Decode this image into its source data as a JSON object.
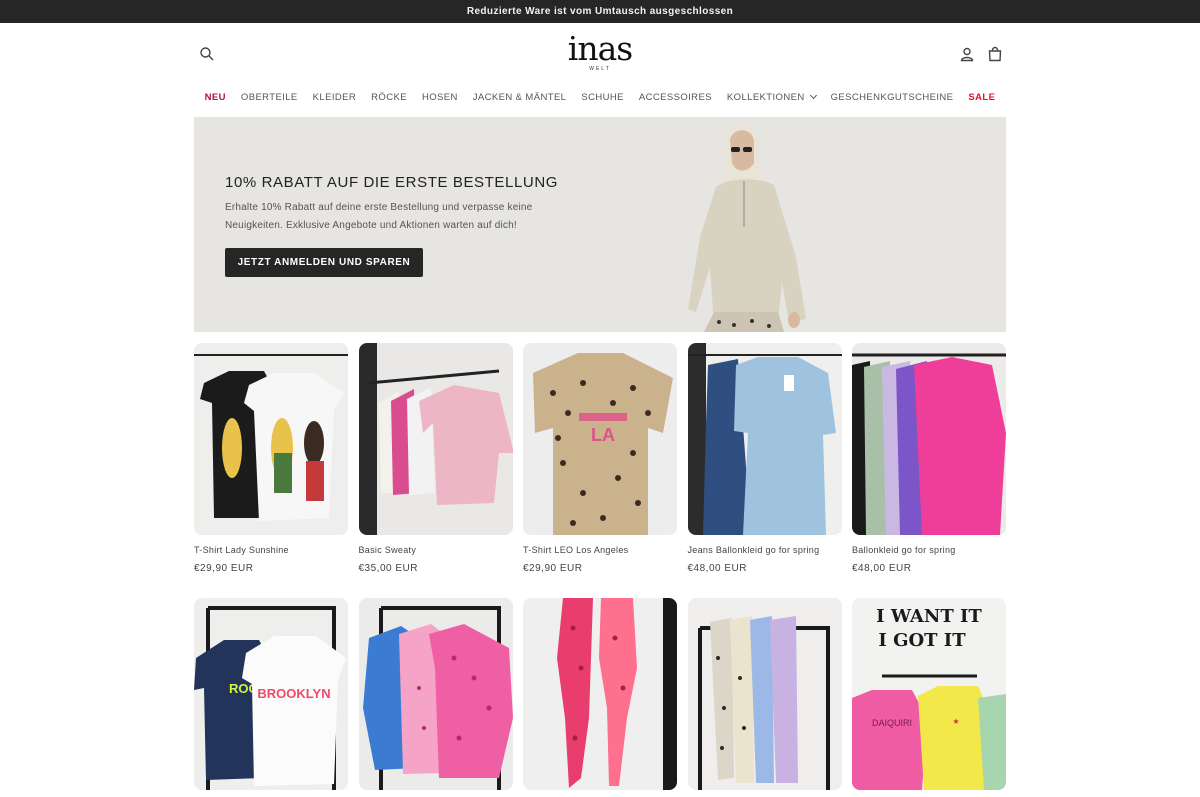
{
  "announcement": {
    "text": "Reduzierte Ware ist vom Umtausch ausgeschlossen"
  },
  "header": {
    "logo_main": "inas",
    "logo_sub": "WELT"
  },
  "nav": {
    "items": [
      {
        "label": "NEU",
        "color": "#b5123c"
      },
      {
        "label": "OBERTEILE"
      },
      {
        "label": "KLEIDER"
      },
      {
        "label": "RÖCKE"
      },
      {
        "label": "HOSEN"
      },
      {
        "label": "JACKEN & MÄNTEL"
      },
      {
        "label": "SCHUHE"
      },
      {
        "label": "ACCESSOIRES"
      },
      {
        "label": "KOLLEKTIONEN"
      },
      {
        "label": "GESCHENKGUTSCHEINE"
      },
      {
        "label": "SALE",
        "color": "#e0122e"
      }
    ]
  },
  "hero": {
    "title": "10% RABATT AUF DIE ERSTE BESTELLUNG",
    "text": "Erhalte 10% Rabatt auf deine erste Bestellung und verpasse keine Neuigkeiten. Exklusive Angebote und Aktionen warten auf dich!",
    "cta": "JETZT ANMELDEN UND SPAREN"
  },
  "products": [
    {
      "title": "T-Shirt Lady Sunshine",
      "price": "€29,90 EUR"
    },
    {
      "title": "Basic Sweaty",
      "price": "€35,00 EUR"
    },
    {
      "title": "T-Shirt LEO Los Angeles",
      "price": "€29,90 EUR"
    },
    {
      "title": "Jeans Ballonkleid go for spring",
      "price": "€48,00 EUR"
    },
    {
      "title": "Ballonkleid go for spring",
      "price": "€48,00 EUR"
    }
  ],
  "second_row": {
    "shirt_text_1": "ROOK",
    "shirt_text_2": "BROOKLYN",
    "sign_line_1": "I WANT IT",
    "sign_line_2": "I GOT IT"
  },
  "colors": {
    "accent_red": "#e0122e",
    "new_red": "#b5123c",
    "dark": "#262626",
    "hero_bg": "#e6e5e1"
  }
}
